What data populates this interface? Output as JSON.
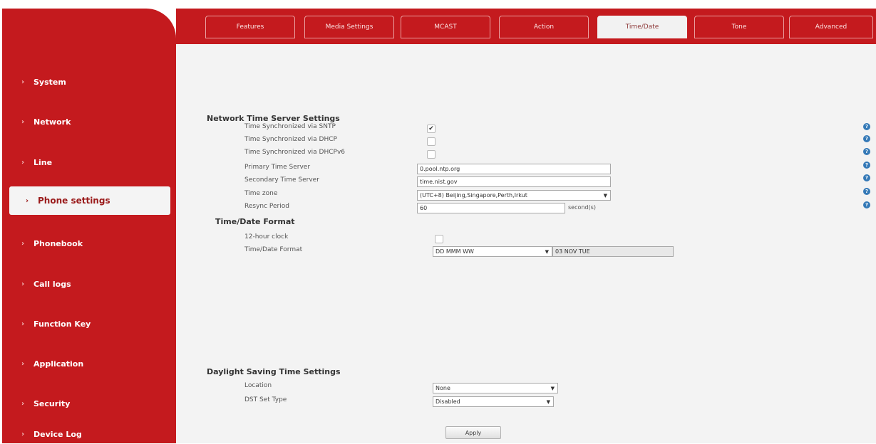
{
  "sidebar": {
    "items": [
      {
        "label": "System"
      },
      {
        "label": "Network"
      },
      {
        "label": "Line"
      },
      {
        "label": "Phone settings"
      },
      {
        "label": "Phonebook"
      },
      {
        "label": "Call logs"
      },
      {
        "label": "Function Key"
      },
      {
        "label": "Application"
      },
      {
        "label": "Security"
      },
      {
        "label": "Device Log"
      }
    ],
    "active": "Phone settings"
  },
  "tabs": [
    {
      "label": "Features"
    },
    {
      "label": "Media Settings"
    },
    {
      "label": "MCAST"
    },
    {
      "label": "Action"
    },
    {
      "label": "Time/Date"
    },
    {
      "label": "Tone"
    },
    {
      "label": "Advanced"
    }
  ],
  "active_tab": "Time/Date",
  "network_time": {
    "title": "Network Time Server Settings",
    "sntp_label": "Time Synchronized via SNTP",
    "sntp_checked": "✔",
    "dhcp_label": "Time Synchronized via DHCP",
    "dhcpv6_label": "Time Synchronized via DHCPv6",
    "primary_label": "Primary Time Server",
    "primary_value": "0.pool.ntp.org",
    "secondary_label": "Secondary Time Server",
    "secondary_value": "time.nist.gov",
    "timezone_label": "Time zone",
    "timezone_value": "(UTC+8) Beijing,Singapore,Perth,Irkut",
    "resync_label": "Resync Period",
    "resync_value": "60",
    "resync_unit": "second(s)"
  },
  "time_format": {
    "title": "Time/Date Format",
    "hour12_label": "12-hour clock",
    "format_label": "Time/Date Format",
    "format_value": "DD MMM WW",
    "format_preview": "03 NOV TUE"
  },
  "dst": {
    "title": "Daylight Saving Time Settings",
    "location_label": "Location",
    "location_value": "None",
    "type_label": "DST Set Type",
    "type_value": "Disabled"
  },
  "apply_label": "Apply",
  "help_glyph": "?",
  "select_arrow": "▼",
  "bullet": "›",
  "colors": {
    "brand_red": "#c41a1e",
    "panel_bg": "#f3f3f3",
    "help_blue": "#3479b7"
  }
}
